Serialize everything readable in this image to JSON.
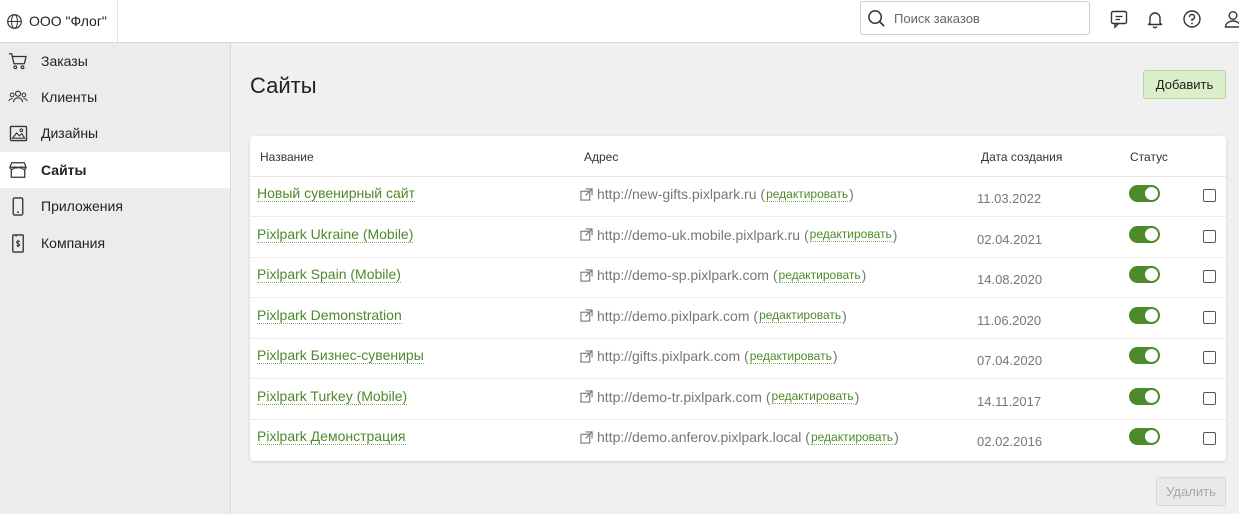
{
  "header": {
    "company_name": "ООО \"Флог\"",
    "search_placeholder": "Поиск заказов",
    "search_value": ""
  },
  "sidebar": {
    "items": [
      {
        "label": "Заказы",
        "icon": "cart-icon",
        "active": false
      },
      {
        "label": "Клиенты",
        "icon": "users-icon",
        "active": false
      },
      {
        "label": "Дизайны",
        "icon": "image-icon",
        "active": false
      },
      {
        "label": "Сайты",
        "icon": "store-icon",
        "active": true
      },
      {
        "label": "Приложения",
        "icon": "phone-icon",
        "active": false
      },
      {
        "label": "Компания",
        "icon": "document-icon",
        "active": false
      }
    ]
  },
  "main": {
    "title": "Сайты",
    "add_label": "Добавить",
    "delete_label": "Удалить",
    "columns": {
      "name": "Название",
      "address": "Адрес",
      "created": "Дата создания",
      "status": "Статус"
    },
    "edit_label": "редактировать",
    "rows": [
      {
        "name": "Новый сувенирный сайт",
        "url": "http://new-gifts.pixlpark.ru",
        "date": "11.03.2022",
        "enabled": true,
        "selected": false
      },
      {
        "name": "Pixlpark Ukraine (Mobile)",
        "url": "http://demo-uk.mobile.pixlpark.ru",
        "date": "02.04.2021",
        "enabled": true,
        "selected": false
      },
      {
        "name": "Pixlpark Spain (Mobile)",
        "url": "http://demo-sp.pixlpark.com",
        "date": "14.08.2020",
        "enabled": true,
        "selected": false
      },
      {
        "name": "Pixlpark Demonstration",
        "url": "http://demo.pixlpark.com",
        "date": "11.06.2020",
        "enabled": true,
        "selected": false
      },
      {
        "name": "Pixlpark Бизнес-сувениры",
        "url": "http://gifts.pixlpark.com",
        "date": "07.04.2020",
        "enabled": true,
        "selected": false
      },
      {
        "name": "Pixlpark Turkey (Mobile)",
        "url": "http://demo-tr.pixlpark.com",
        "date": "14.11.2017",
        "enabled": true,
        "selected": false
      },
      {
        "name": "Pixlpark Демонстрация",
        "url": "http://demo.anferov.pixlpark.local",
        "date": "02.02.2016",
        "enabled": true,
        "selected": false
      }
    ]
  },
  "colors": {
    "accent": "#4c8a2a",
    "add_button_bg": "#d9eec9",
    "sidebar_bg": "#ececec"
  }
}
